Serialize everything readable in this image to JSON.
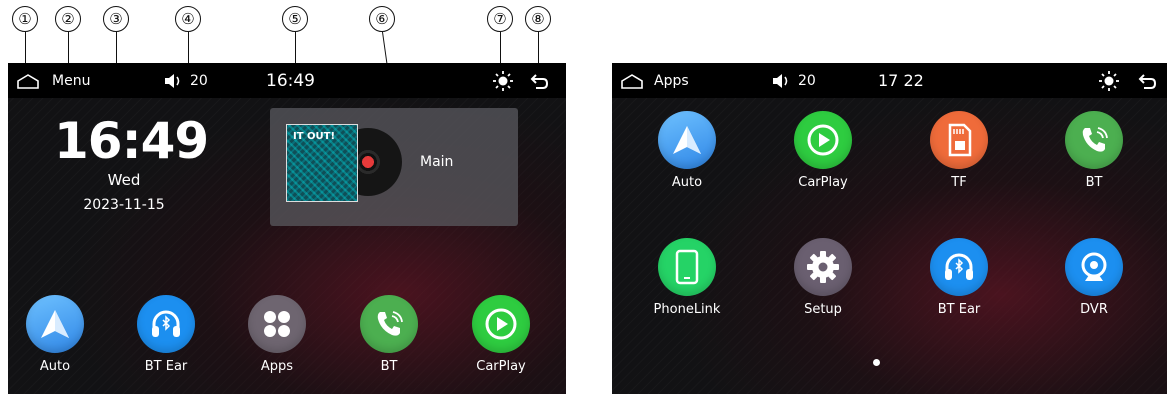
{
  "callouts": [
    "①",
    "②",
    "③",
    "④",
    "⑤",
    "⑥",
    "⑦",
    "⑧"
  ],
  "home": {
    "status": {
      "menu_label": "Menu",
      "volume": "20",
      "time": "16:49"
    },
    "clock": {
      "time": "16:49",
      "day": "Wed",
      "date": "2023-11-15"
    },
    "media": {
      "album_text": "IT OUT!",
      "track": "Main"
    },
    "dock": [
      {
        "label": "Auto",
        "icon": "android-auto-icon"
      },
      {
        "label": "BT Ear",
        "icon": "bluetooth-headphones-icon"
      },
      {
        "label": "Apps",
        "icon": "apps-grid-icon"
      },
      {
        "label": "BT",
        "icon": "phone-icon"
      },
      {
        "label": "CarPlay",
        "icon": "carplay-icon"
      }
    ]
  },
  "apps": {
    "status": {
      "title": "Apps",
      "volume": "20",
      "time": "17 22"
    },
    "grid": [
      {
        "label": "Auto",
        "icon": "android-auto-icon"
      },
      {
        "label": "CarPlay",
        "icon": "carplay-icon"
      },
      {
        "label": "TF",
        "icon": "sd-card-icon"
      },
      {
        "label": "BT",
        "icon": "phone-icon"
      },
      {
        "label": "PhoneLink",
        "icon": "smartphone-icon"
      },
      {
        "label": "Setup",
        "icon": "gear-icon"
      },
      {
        "label": "BT Ear",
        "icon": "bluetooth-headphones-icon"
      },
      {
        "label": "DVR",
        "icon": "camera-icon"
      }
    ],
    "page_indicator": {
      "current": 1,
      "total": 1
    }
  },
  "colors": {
    "auto": "#3b9cf0",
    "bt_ear": "#1c8ff0",
    "apps": "#6e6570",
    "bt": "#4caf50",
    "carplay": "#2ecc40",
    "tf": "#ef6b3a",
    "phonelink": "#25d366",
    "setup": "#6a5f70",
    "dvr": "#1c8ff0"
  }
}
